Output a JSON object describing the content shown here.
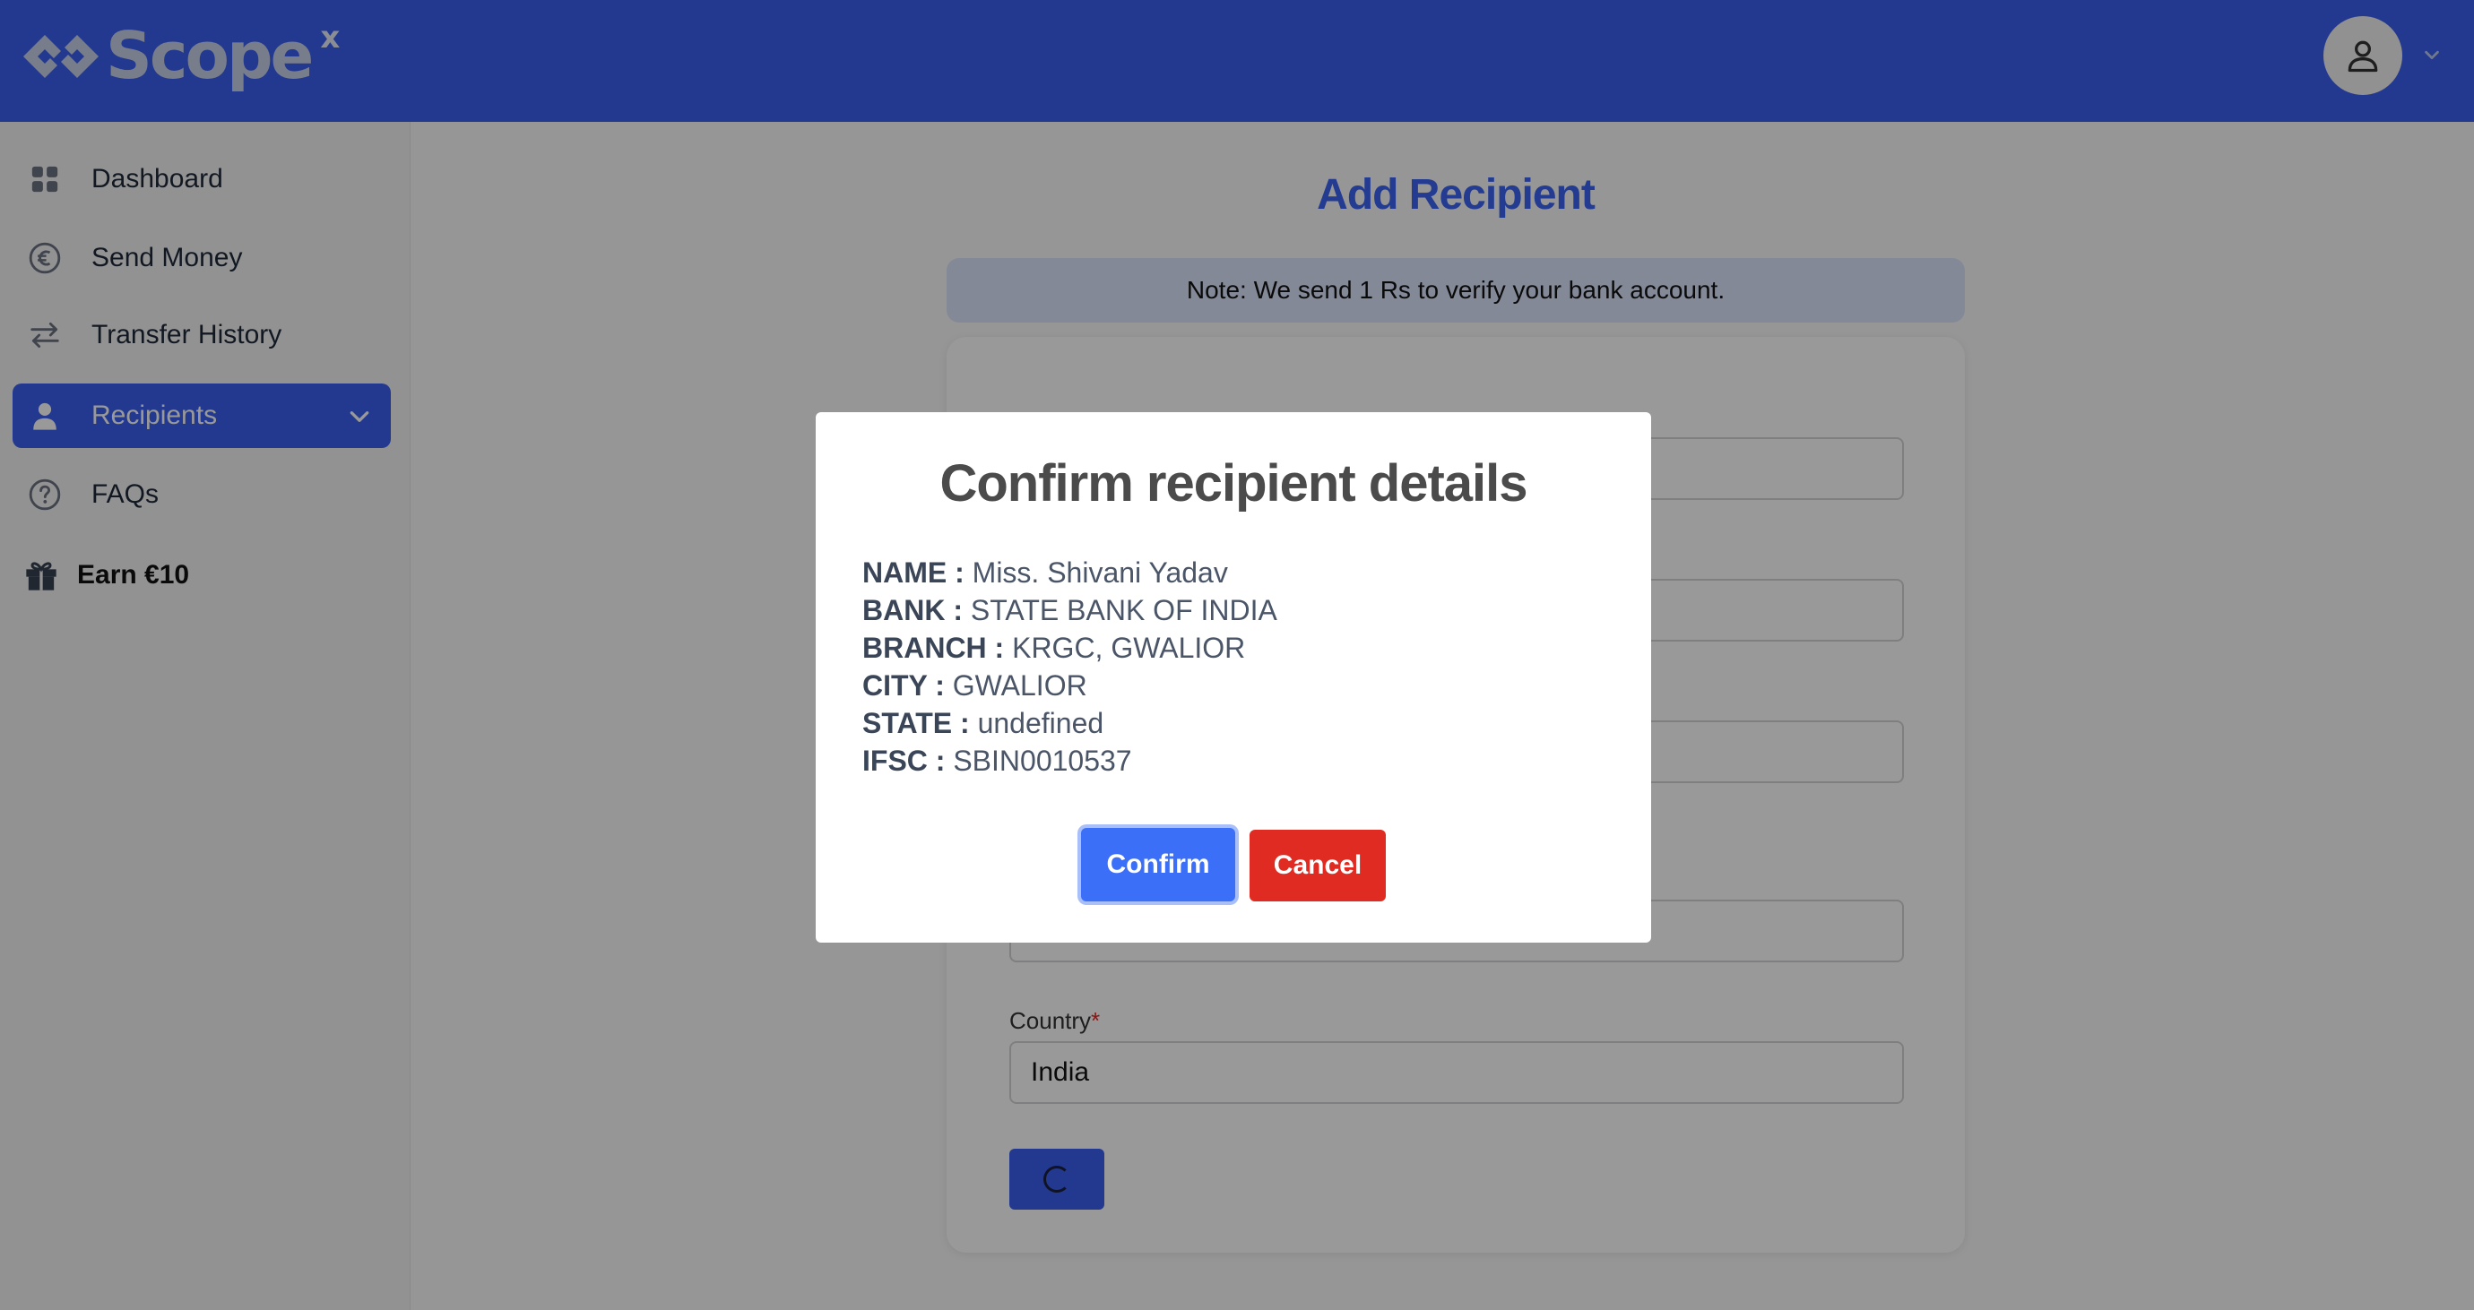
{
  "header": {
    "brand": "Scope",
    "brand_sup": "x"
  },
  "sidebar": {
    "items": [
      {
        "label": "Dashboard",
        "icon": "grid-icon"
      },
      {
        "label": "Send Money",
        "icon": "euro-coin-icon"
      },
      {
        "label": "Transfer History",
        "icon": "arrows-swap-icon"
      },
      {
        "label": "Recipients",
        "icon": "user-icon",
        "active": true
      },
      {
        "label": "FAQs",
        "icon": "question-circle-icon"
      }
    ],
    "earn_label": "Earn €10"
  },
  "main": {
    "title": "Add Recipient",
    "note": "Note: We send 1 Rs to verify your bank account.",
    "country_label": "Country",
    "country_value": "India"
  },
  "modal": {
    "title": "Confirm recipient details",
    "details": [
      {
        "key": "NAME :",
        "value": "Miss. Shivani Yadav"
      },
      {
        "key": "BANK :",
        "value": "STATE BANK OF INDIA"
      },
      {
        "key": "BRANCH :",
        "value": "KRGC, GWALIOR"
      },
      {
        "key": "CITY :",
        "value": "GWALIOR"
      },
      {
        "key": "STATE :",
        "value": "undefined"
      },
      {
        "key": "IFSC :",
        "value": "SBIN0010537"
      }
    ],
    "confirm_label": "Confirm",
    "cancel_label": "Cancel"
  },
  "colors": {
    "primary": "#3b5ff0",
    "danger": "#e02b22",
    "title_blue": "#3b63f0"
  }
}
